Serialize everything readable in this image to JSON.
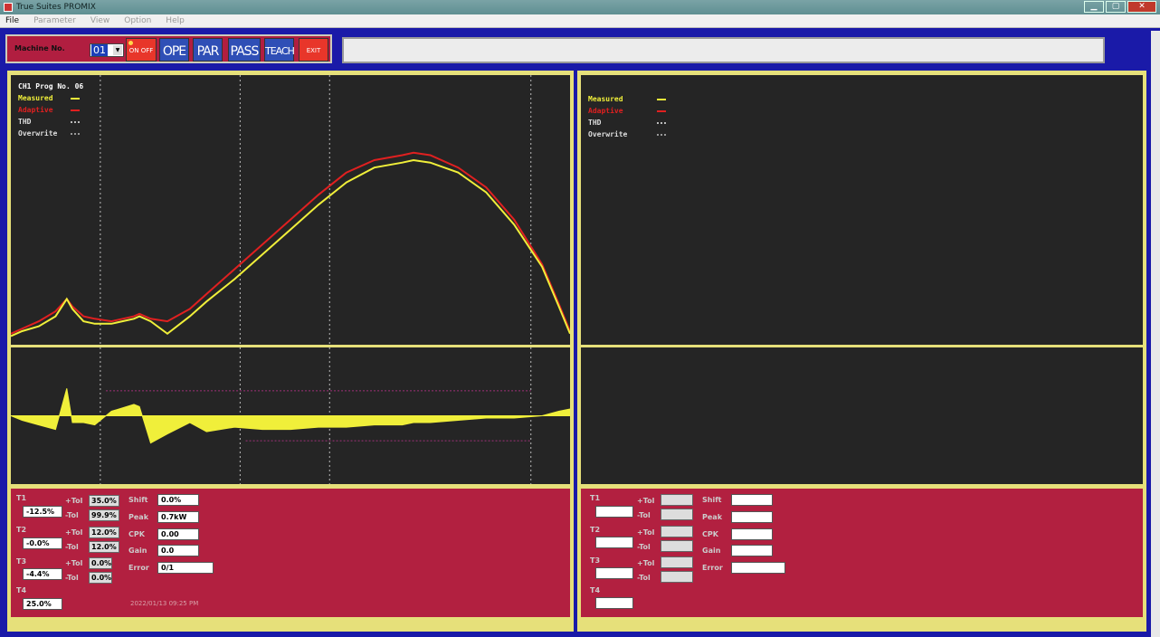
{
  "window": {
    "title": "True Suites PROMIX"
  },
  "menu": [
    {
      "label": "File",
      "active": true
    },
    {
      "label": "Parameter",
      "active": false
    },
    {
      "label": "View",
      "active": false
    },
    {
      "label": "Option",
      "active": false
    },
    {
      "label": "Help",
      "active": false
    }
  ],
  "toolbar": {
    "machine_label": "Machine No.",
    "machine_value": "01",
    "buttons": [
      {
        "label": "ON OFF",
        "color": "red"
      },
      {
        "label": "OPE",
        "color": "blue"
      },
      {
        "label": "PAR",
        "color": "blue"
      },
      {
        "label": "PASS",
        "color": "blue"
      },
      {
        "label": "TEACH",
        "color": "blue"
      },
      {
        "label": "EXIT",
        "color": "red"
      }
    ]
  },
  "left": {
    "chart_title": "CH1 Prog No. 06",
    "legend": [
      {
        "label": "Measured",
        "color": "#f0ef3a"
      },
      {
        "label": "Adaptive",
        "color": "#e02020"
      },
      {
        "label": "THD",
        "color": "#bbbbbb"
      },
      {
        "label": "Overwrite",
        "color": "#999999"
      }
    ],
    "t_labels": [
      "T1",
      "T2",
      "T3",
      "T4"
    ],
    "t_values": [
      "-12.5%",
      "-0.0%",
      "-4.4%",
      "25.0%"
    ],
    "tol_labels": [
      "+Tol",
      "-Tol",
      "+Tol",
      "-Tol",
      "+Tol",
      "-Tol"
    ],
    "tol_values": [
      "35.0%",
      "99.9%",
      "12.0%",
      "12.0%",
      "0.0%",
      "0.0%"
    ],
    "stat_labels": [
      "Shift",
      "Peak",
      "CPK",
      "Gain",
      "Error"
    ],
    "stat_values": [
      "0.0%",
      "0.7kW",
      "0.00",
      "0.0",
      "0/1"
    ],
    "timestamp": "2022/01/13 09:25 PM"
  },
  "right": {
    "legend": [
      {
        "label": "Measured",
        "color": "#f0ef3a"
      },
      {
        "label": "Adaptive",
        "color": "#e02020"
      },
      {
        "label": "THD",
        "color": "#bbbbbb"
      },
      {
        "label": "Overwrite",
        "color": "#999999"
      }
    ],
    "t_labels": [
      "T1",
      "T2",
      "T3",
      "T4"
    ],
    "tol_labels": [
      "+Tol",
      "-Tol",
      "+Tol",
      "-Tol",
      "+Tol",
      "-Tol"
    ],
    "stat_labels": [
      "Shift",
      "Peak",
      "CPK",
      "Gain",
      "Error"
    ]
  },
  "chart_data": {
    "type": "line",
    "x": [
      0,
      2,
      5,
      8,
      10,
      11,
      13,
      15,
      18,
      22,
      23,
      25,
      28,
      32,
      35,
      40,
      45,
      50,
      55,
      60,
      65,
      70,
      72,
      75,
      80,
      85,
      90,
      95,
      98,
      100
    ],
    "series": [
      {
        "name": "Measured",
        "values": [
          2,
          4,
          6,
          10,
          17,
          13,
          8,
          7,
          7,
          9,
          10,
          8,
          3,
          10,
          16,
          25,
          35,
          45,
          55,
          64,
          70,
          72,
          73,
          72,
          68,
          60,
          47,
          30,
          14,
          3
        ]
      },
      {
        "name": "Adaptive",
        "values": [
          3,
          5,
          8,
          12,
          17,
          14,
          10,
          9,
          8,
          10,
          11,
          9,
          8,
          13,
          19,
          29,
          39,
          49,
          59,
          68,
          73,
          75,
          76,
          75,
          70,
          62,
          49,
          31,
          15,
          4
        ]
      }
    ],
    "difference": [
      0,
      -2,
      -4,
      -6,
      12,
      -3,
      -3,
      -4,
      2,
      5,
      4,
      -12,
      -8,
      -3,
      -7,
      -5,
      -6,
      -6,
      -5,
      -5,
      -4,
      -4,
      -3,
      -3,
      -2,
      -1,
      -1,
      0,
      2,
      3
    ],
    "xlim": [
      0,
      100
    ],
    "ylim": [
      0,
      100
    ],
    "diff_ylim": [
      -30,
      30
    ]
  }
}
